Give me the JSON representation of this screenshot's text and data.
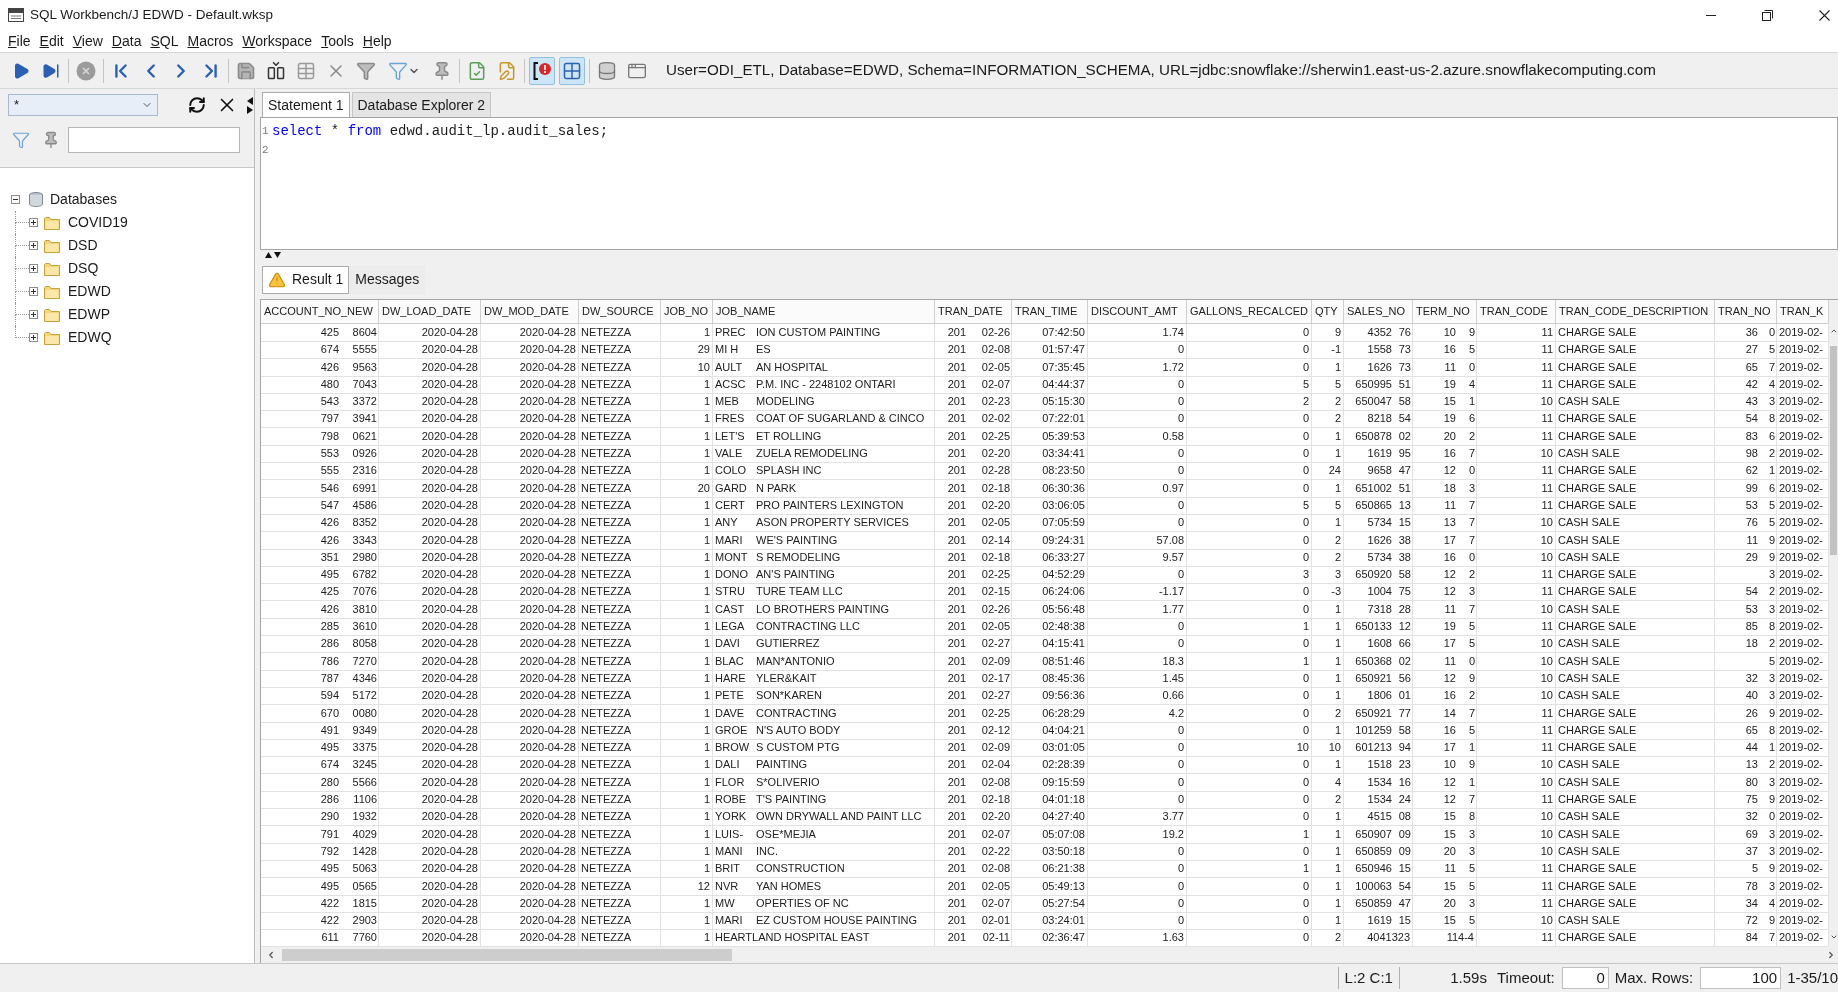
{
  "window": {
    "title": "SQL Workbench/J EDWD - Default.wksp"
  },
  "menu": [
    "File",
    "Edit",
    "View",
    "Data",
    "SQL",
    "Macros",
    "Workspace",
    "Tools",
    "Help"
  ],
  "toolbar": {
    "toggles": [
      {
        "pressed": true
      },
      {
        "pressed": true
      }
    ],
    "connection": "User=ODI_ETL, Database=EDWD, Schema=INFORMATION_SCHEMA, URL=jdbc:snowflake://sherwin1.east-us-2.azure.snowflakecomputing.com"
  },
  "object_panel": {
    "type_filter": "*",
    "tree": [
      {
        "label": "Databases",
        "expanded": true,
        "children": [
          {
            "label": "COVID19",
            "expanded": false
          },
          {
            "label": "DSD",
            "expanded": false
          },
          {
            "label": "DSQ",
            "expanded": false
          },
          {
            "label": "EDWD",
            "expanded": false
          },
          {
            "label": "EDWP",
            "expanded": false
          },
          {
            "label": "EDWQ",
            "expanded": false
          }
        ]
      }
    ]
  },
  "editor_tabs": [
    {
      "label": "Statement 1",
      "selected": true
    },
    {
      "label": "Database Explorer 2",
      "selected": false
    }
  ],
  "editor": {
    "lines": [
      {
        "number": "1",
        "tokens": [
          {
            "text": "select",
            "kind": "keyword"
          },
          {
            "text": " * ",
            "kind": "plain"
          },
          {
            "text": "from",
            "kind": "keyword"
          },
          {
            "text": " edwd.audit_lp.audit_sales;",
            "kind": "plain"
          }
        ]
      },
      {
        "number": "2"
      }
    ]
  },
  "result_tabs": [
    {
      "label": "Result 1",
      "selected": true,
      "warning": true
    },
    {
      "label": "Messages",
      "selected": false,
      "warning": false
    }
  ],
  "table": {
    "columns": [
      {
        "label": "ACCOUNT_NO_NEW",
        "kind": "number"
      },
      {
        "label": "DW_LOAD_DATE",
        "kind": "date"
      },
      {
        "label": "DW_MOD_DATE",
        "kind": "date"
      },
      {
        "label": "DW_SOURCE",
        "kind": "text"
      },
      {
        "label": "JOB_NO",
        "kind": "number"
      },
      {
        "label": "JOB_NAME",
        "kind": "text"
      },
      {
        "label": "TRAN_DATE",
        "kind": "date"
      },
      {
        "label": "TRAN_TIME",
        "kind": "time"
      },
      {
        "label": "DISCOUNT_AMT",
        "kind": "number"
      },
      {
        "label": "GALLONS_RECALCED",
        "kind": "number"
      },
      {
        "label": "QTY",
        "kind": "number"
      },
      {
        "label": "SALES_NO",
        "kind": "number"
      },
      {
        "label": "TERM_NO",
        "kind": "number"
      },
      {
        "label": "TRAN_CODE",
        "kind": "number"
      },
      {
        "label": "TRAN_CODE_DESCRIPTION",
        "kind": "text"
      },
      {
        "label": "TRAN_NO",
        "kind": "number"
      },
      {
        "label": "TRAN_K",
        "kind": "text"
      }
    ],
    "rows": [
      [
        [
          "425",
          "8604"
        ],
        "2020-04-28",
        "2020-04-28",
        "NETEZZA",
        "1",
        [
          "PREC",
          "ION CUSTOM PAINTING"
        ],
        [
          "201",
          "02-26"
        ],
        "07:42:50",
        "1.74",
        "0",
        "9",
        [
          "4352",
          "76"
        ],
        [
          "10",
          "9"
        ],
        "11",
        "CHARGE SALE",
        [
          "36",
          "0"
        ],
        "2019-02-"
      ],
      [
        [
          "674",
          "5555"
        ],
        "2020-04-28",
        "2020-04-28",
        "NETEZZA",
        "29",
        [
          "MI H",
          "ES"
        ],
        [
          "201",
          "02-08"
        ],
        "01:57:47",
        "0",
        "0",
        "-1",
        [
          "1558",
          "73"
        ],
        [
          "16",
          "5"
        ],
        "11",
        "CHARGE SALE",
        [
          "27",
          "5"
        ],
        "2019-02-"
      ],
      [
        [
          "426",
          "9563"
        ],
        "2020-04-28",
        "2020-04-28",
        "NETEZZA",
        "10",
        [
          "AULT",
          "AN HOSPITAL"
        ],
        [
          "201",
          "02-05"
        ],
        "07:35:45",
        "1.72",
        "0",
        "1",
        [
          "1626",
          "73"
        ],
        [
          "11",
          "0"
        ],
        "11",
        "CHARGE SALE",
        [
          "65",
          "7"
        ],
        "2019-02-"
      ],
      [
        [
          "480",
          "7043"
        ],
        "2020-04-28",
        "2020-04-28",
        "NETEZZA",
        "1",
        [
          "ACSC",
          "P.M. INC - 2248102 ONTARI"
        ],
        [
          "201",
          "02-07"
        ],
        "04:44:37",
        "0",
        "5",
        "5",
        [
          "650995",
          "51"
        ],
        [
          "19",
          "4"
        ],
        "11",
        "CHARGE SALE",
        [
          "42",
          "4"
        ],
        "2019-02-"
      ],
      [
        [
          "543",
          "3372"
        ],
        "2020-04-28",
        "2020-04-28",
        "NETEZZA",
        "1",
        [
          "MEB",
          "MODELING"
        ],
        [
          "201",
          "02-23"
        ],
        "05:15:30",
        "0",
        "2",
        "2",
        [
          "650047",
          "58"
        ],
        [
          "15",
          "1"
        ],
        "10",
        "CASH SALE",
        [
          "43",
          "3"
        ],
        "2019-02-"
      ],
      [
        [
          "797",
          "3941"
        ],
        "2020-04-28",
        "2020-04-28",
        "NETEZZA",
        "1",
        [
          "FRES",
          "COAT OF SUGARLAND & CINCO"
        ],
        [
          "201",
          "02-02"
        ],
        "07:22:01",
        "0",
        "0",
        "2",
        [
          "8218",
          "54"
        ],
        [
          "19",
          "6"
        ],
        "11",
        "CHARGE SALE",
        [
          "54",
          "8"
        ],
        "2019-02-"
      ],
      [
        [
          "798",
          "0621"
        ],
        "2020-04-28",
        "2020-04-28",
        "NETEZZA",
        "1",
        [
          "LET'S",
          "ET ROLLING"
        ],
        [
          "201",
          "02-25"
        ],
        "05:39:53",
        "0.58",
        "0",
        "1",
        [
          "650878",
          "02"
        ],
        [
          "20",
          "2"
        ],
        "11",
        "CHARGE SALE",
        [
          "83",
          "6"
        ],
        "2019-02-"
      ],
      [
        [
          "553",
          "0926"
        ],
        "2020-04-28",
        "2020-04-28",
        "NETEZZA",
        "1",
        [
          "VALE",
          "ZUELA REMODELING"
        ],
        [
          "201",
          "02-20"
        ],
        "03:34:41",
        "0",
        "0",
        "1",
        [
          "1619",
          "95"
        ],
        [
          "16",
          "7"
        ],
        "10",
        "CASH SALE",
        [
          "98",
          "2"
        ],
        "2019-02-"
      ],
      [
        [
          "555",
          "2316"
        ],
        "2020-04-28",
        "2020-04-28",
        "NETEZZA",
        "1",
        [
          "COLO",
          "SPLASH INC"
        ],
        [
          "201",
          "02-28"
        ],
        "08:23:50",
        "0",
        "0",
        "24",
        [
          "9658",
          "47"
        ],
        [
          "12",
          "0"
        ],
        "11",
        "CHARGE SALE",
        [
          "62",
          "1"
        ],
        "2019-02-"
      ],
      [
        [
          "546",
          "6991"
        ],
        "2020-04-28",
        "2020-04-28",
        "NETEZZA",
        "20",
        [
          "GARD",
          "N PARK"
        ],
        [
          "201",
          "02-18"
        ],
        "06:30:36",
        "0.97",
        "0",
        "1",
        [
          "651002",
          "51"
        ],
        [
          "18",
          "3"
        ],
        "11",
        "CHARGE SALE",
        [
          "99",
          "6"
        ],
        "2019-02-"
      ],
      [
        [
          "547",
          "4586"
        ],
        "2020-04-28",
        "2020-04-28",
        "NETEZZA",
        "1",
        [
          "CERT",
          "PRO PAINTERS LEXINGTON"
        ],
        [
          "201",
          "02-20"
        ],
        "03:06:05",
        "0",
        "5",
        "5",
        [
          "650865",
          "13"
        ],
        [
          "11",
          "7"
        ],
        "11",
        "CHARGE SALE",
        [
          "53",
          "5"
        ],
        "2019-02-"
      ],
      [
        [
          "426",
          "8352"
        ],
        "2020-04-28",
        "2020-04-28",
        "NETEZZA",
        "1",
        [
          "ANY",
          "ASON PROPERTY SERVICES"
        ],
        [
          "201",
          "02-05"
        ],
        "07:05:59",
        "0",
        "0",
        "1",
        [
          "5734",
          "15"
        ],
        [
          "13",
          "7"
        ],
        "10",
        "CASH SALE",
        [
          "76",
          "5"
        ],
        "2019-02-"
      ],
      [
        [
          "426",
          "3343"
        ],
        "2020-04-28",
        "2020-04-28",
        "NETEZZA",
        "1",
        [
          "MARI",
          "WE'S PAINTING"
        ],
        [
          "201",
          "02-14"
        ],
        "09:24:31",
        "57.08",
        "0",
        "2",
        [
          "1626",
          "38"
        ],
        [
          "17",
          "7"
        ],
        "10",
        "CASH SALE",
        [
          "11",
          "9"
        ],
        "2019-02-"
      ],
      [
        [
          "351",
          "2980"
        ],
        "2020-04-28",
        "2020-04-28",
        "NETEZZA",
        "1",
        [
          "MONT",
          "S REMODELING"
        ],
        [
          "201",
          "02-18"
        ],
        "06:33:27",
        "9.57",
        "0",
        "2",
        [
          "5734",
          "38"
        ],
        [
          "16",
          "0"
        ],
        "10",
        "CASH SALE",
        [
          "29",
          "9"
        ],
        "2019-02-"
      ],
      [
        [
          "495",
          "6782"
        ],
        "2020-04-28",
        "2020-04-28",
        "NETEZZA",
        "1",
        [
          "DONO",
          "AN'S PAINTING"
        ],
        [
          "201",
          "02-25"
        ],
        "04:52:29",
        "0",
        "3",
        "3",
        [
          "650920",
          "58"
        ],
        [
          "12",
          "2"
        ],
        "11",
        "CHARGE SALE",
        [
          null,
          "3"
        ],
        "2019-02-"
      ],
      [
        [
          "425",
          "7076"
        ],
        "2020-04-28",
        "2020-04-28",
        "NETEZZA",
        "1",
        [
          "STRU",
          "TURE TEAM LLC"
        ],
        [
          "201",
          "02-15"
        ],
        "06:24:06",
        "-1.17",
        "0",
        "-3",
        [
          "1004",
          "75"
        ],
        [
          "12",
          "3"
        ],
        "11",
        "CHARGE SALE",
        [
          "54",
          "2"
        ],
        "2019-02-"
      ],
      [
        [
          "426",
          "3810"
        ],
        "2020-04-28",
        "2020-04-28",
        "NETEZZA",
        "1",
        [
          "CAST",
          "LO BROTHERS PAINTING"
        ],
        [
          "201",
          "02-26"
        ],
        "05:56:48",
        "1.77",
        "0",
        "1",
        [
          "7318",
          "28"
        ],
        [
          "11",
          "7"
        ],
        "10",
        "CASH SALE",
        [
          "53",
          "3"
        ],
        "2019-02-"
      ],
      [
        [
          "285",
          "3610"
        ],
        "2020-04-28",
        "2020-04-28",
        "NETEZZA",
        "1",
        [
          "LEGA",
          "CONTRACTING LLC"
        ],
        [
          "201",
          "02-05"
        ],
        "02:48:38",
        "0",
        "1",
        "1",
        [
          "650133",
          "12"
        ],
        [
          "19",
          "5"
        ],
        "11",
        "CHARGE SALE",
        [
          "85",
          "8"
        ],
        "2019-02-"
      ],
      [
        [
          "286",
          "8058"
        ],
        "2020-04-28",
        "2020-04-28",
        "NETEZZA",
        "1",
        [
          "DAVI",
          "GUTIERREZ"
        ],
        [
          "201",
          "02-27"
        ],
        "04:15:41",
        "0",
        "0",
        "1",
        [
          "1608",
          "66"
        ],
        [
          "17",
          "5"
        ],
        "10",
        "CASH SALE",
        [
          "18",
          "2"
        ],
        "2019-02-"
      ],
      [
        [
          "786",
          "7270"
        ],
        "2020-04-28",
        "2020-04-28",
        "NETEZZA",
        "1",
        [
          "BLAC",
          "MAN*ANTONIO"
        ],
        [
          "201",
          "02-09"
        ],
        "08:51:46",
        "18.3",
        "1",
        "1",
        [
          "650368",
          "02"
        ],
        [
          "11",
          "0"
        ],
        "10",
        "CASH SALE",
        [
          null,
          "5"
        ],
        "2019-02-"
      ],
      [
        [
          "787",
          "4346"
        ],
        "2020-04-28",
        "2020-04-28",
        "NETEZZA",
        "1",
        [
          "HARE",
          "YLER&KAIT"
        ],
        [
          "201",
          "02-17"
        ],
        "08:45:36",
        "1.45",
        "0",
        "1",
        [
          "650921",
          "56"
        ],
        [
          "12",
          "9"
        ],
        "10",
        "CASH SALE",
        [
          "32",
          "3"
        ],
        "2019-02-"
      ],
      [
        [
          "594",
          "5172"
        ],
        "2020-04-28",
        "2020-04-28",
        "NETEZZA",
        "1",
        [
          "PETE",
          "SON*KAREN"
        ],
        [
          "201",
          "02-27"
        ],
        "09:56:36",
        "0.66",
        "0",
        "1",
        [
          "1806",
          "01"
        ],
        [
          "16",
          "2"
        ],
        "10",
        "CASH SALE",
        [
          "40",
          "3"
        ],
        "2019-02-"
      ],
      [
        [
          "670",
          "0080"
        ],
        "2020-04-28",
        "2020-04-28",
        "NETEZZA",
        "1",
        [
          "DAVE",
          "CONTRACTING"
        ],
        [
          "201",
          "02-25"
        ],
        "06:28:29",
        "4.2",
        "0",
        "2",
        [
          "650921",
          "77"
        ],
        [
          "14",
          "7"
        ],
        "11",
        "CHARGE SALE",
        [
          "26",
          "9"
        ],
        "2019-02-"
      ],
      [
        [
          "491",
          "9349"
        ],
        "2020-04-28",
        "2020-04-28",
        "NETEZZA",
        "1",
        [
          "GROE",
          "N'S AUTO BODY"
        ],
        [
          "201",
          "02-12"
        ],
        "04:04:21",
        "0",
        "0",
        "1",
        [
          "101259",
          "58"
        ],
        [
          "16",
          "5"
        ],
        "11",
        "CHARGE SALE",
        [
          "65",
          "8"
        ],
        "2019-02-"
      ],
      [
        [
          "495",
          "3375"
        ],
        "2020-04-28",
        "2020-04-28",
        "NETEZZA",
        "1",
        [
          "BROW",
          "S CUSTOM PTG"
        ],
        [
          "201",
          "02-09"
        ],
        "03:01:05",
        "0",
        "10",
        "10",
        [
          "601213",
          "94"
        ],
        [
          "17",
          "1"
        ],
        "11",
        "CHARGE SALE",
        [
          "44",
          "1"
        ],
        "2019-02-"
      ],
      [
        [
          "674",
          "3245"
        ],
        "2020-04-28",
        "2020-04-28",
        "NETEZZA",
        "1",
        [
          "DALI",
          "PAINTING"
        ],
        [
          "201",
          "02-04"
        ],
        "02:28:39",
        "0",
        "0",
        "1",
        [
          "1518",
          "23"
        ],
        [
          "10",
          "9"
        ],
        "10",
        "CASH SALE",
        [
          "13",
          "2"
        ],
        "2019-02-"
      ],
      [
        [
          "280",
          "5566"
        ],
        "2020-04-28",
        "2020-04-28",
        "NETEZZA",
        "1",
        [
          "FLOR",
          "S*OLIVERIO"
        ],
        [
          "201",
          "02-08"
        ],
        "09:15:59",
        "0",
        "0",
        "4",
        [
          "1534",
          "16"
        ],
        [
          "12",
          "1"
        ],
        "10",
        "CASH SALE",
        [
          "80",
          "3"
        ],
        "2019-02-"
      ],
      [
        [
          "286",
          "1106"
        ],
        "2020-04-28",
        "2020-04-28",
        "NETEZZA",
        "1",
        [
          "ROBE",
          "T'S PAINTING"
        ],
        [
          "201",
          "02-18"
        ],
        "04:01:18",
        "0",
        "0",
        "2",
        [
          "1534",
          "24"
        ],
        [
          "12",
          "7"
        ],
        "11",
        "CHARGE SALE",
        [
          "75",
          "9"
        ],
        "2019-02-"
      ],
      [
        [
          "290",
          "1932"
        ],
        "2020-04-28",
        "2020-04-28",
        "NETEZZA",
        "1",
        [
          "YORK",
          "OWN DRYWALL AND PAINT LLC"
        ],
        [
          "201",
          "02-20"
        ],
        "04:27:40",
        "3.77",
        "0",
        "1",
        [
          "4515",
          "08"
        ],
        [
          "15",
          "8"
        ],
        "10",
        "CASH SALE",
        [
          "32",
          "0"
        ],
        "2019-02-"
      ],
      [
        [
          "791",
          "4029"
        ],
        "2020-04-28",
        "2020-04-28",
        "NETEZZA",
        "1",
        [
          "LUIS-",
          "OSE*MEJIA"
        ],
        [
          "201",
          "02-07"
        ],
        "05:07:08",
        "19.2",
        "1",
        "1",
        [
          "650907",
          "09"
        ],
        [
          "15",
          "3"
        ],
        "10",
        "CASH SALE",
        [
          "69",
          "3"
        ],
        "2019-02-"
      ],
      [
        [
          "792",
          "1428"
        ],
        "2020-04-28",
        "2020-04-28",
        "NETEZZA",
        "1",
        [
          "MANI",
          "INC."
        ],
        [
          "201",
          "02-22"
        ],
        "03:50:18",
        "0",
        "0",
        "1",
        [
          "650859",
          "09"
        ],
        [
          "20",
          "3"
        ],
        "10",
        "CASH SALE",
        [
          "37",
          "3"
        ],
        "2019-02-"
      ],
      [
        [
          "495",
          "5063"
        ],
        "2020-04-28",
        "2020-04-28",
        "NETEZZA",
        "1",
        [
          "BRIT",
          "CONSTRUCTION"
        ],
        [
          "201",
          "02-08"
        ],
        "06:21:38",
        "0",
        "1",
        "1",
        [
          "650946",
          "15"
        ],
        [
          "11",
          "5"
        ],
        "11",
        "CHARGE SALE",
        [
          "5",
          "9"
        ],
        "2019-02-"
      ],
      [
        [
          "495",
          "0565"
        ],
        "2020-04-28",
        "2020-04-28",
        "NETEZZA",
        "12",
        [
          "NVR",
          "YAN HOMES"
        ],
        [
          "201",
          "02-05"
        ],
        "05:49:13",
        "0",
        "0",
        "1",
        [
          "100063",
          "54"
        ],
        [
          "15",
          "5"
        ],
        "11",
        "CHARGE SALE",
        [
          "78",
          "3"
        ],
        "2019-02-"
      ],
      [
        [
          "422",
          "1815"
        ],
        "2020-04-28",
        "2020-04-28",
        "NETEZZA",
        "1",
        [
          "MW",
          "OPERTIES OF NC"
        ],
        [
          "201",
          "02-07"
        ],
        "05:27:54",
        "0",
        "0",
        "1",
        [
          "650859",
          "47"
        ],
        [
          "20",
          "3"
        ],
        "11",
        "CHARGE SALE",
        [
          "34",
          "4"
        ],
        "2019-02-"
      ],
      [
        [
          "422",
          "2903"
        ],
        "2020-04-28",
        "2020-04-28",
        "NETEZZA",
        "1",
        [
          "MARI",
          "EZ CUSTOM HOUSE PAINTING"
        ],
        [
          "201",
          "02-01"
        ],
        "03:24:01",
        "0",
        "0",
        "1",
        [
          "1619",
          "15"
        ],
        [
          "15",
          "5"
        ],
        "10",
        "CASH SALE",
        [
          "72",
          "9"
        ],
        "2019-02-"
      ],
      [
        [
          "611",
          "7760"
        ],
        "2020-04-28",
        "2020-04-28",
        "NETEZZA",
        "1",
        "HEARTLAND HOSPITAL EAST",
        [
          "201",
          "02-11"
        ],
        "02:36:47",
        "1.63",
        "0",
        "2",
        "4041323",
        "114-4",
        "11",
        "CHARGE SALE",
        [
          "84",
          "7"
        ],
        "2019-02-"
      ]
    ]
  },
  "status_bar": {
    "cursor": "L:2 C:1",
    "elapsed": "1.59s",
    "timeout_label": "Timeout:",
    "timeout": "0",
    "max_rows_label": "Max. Rows:",
    "max_rows": "100",
    "row_range": "1-35/10"
  }
}
